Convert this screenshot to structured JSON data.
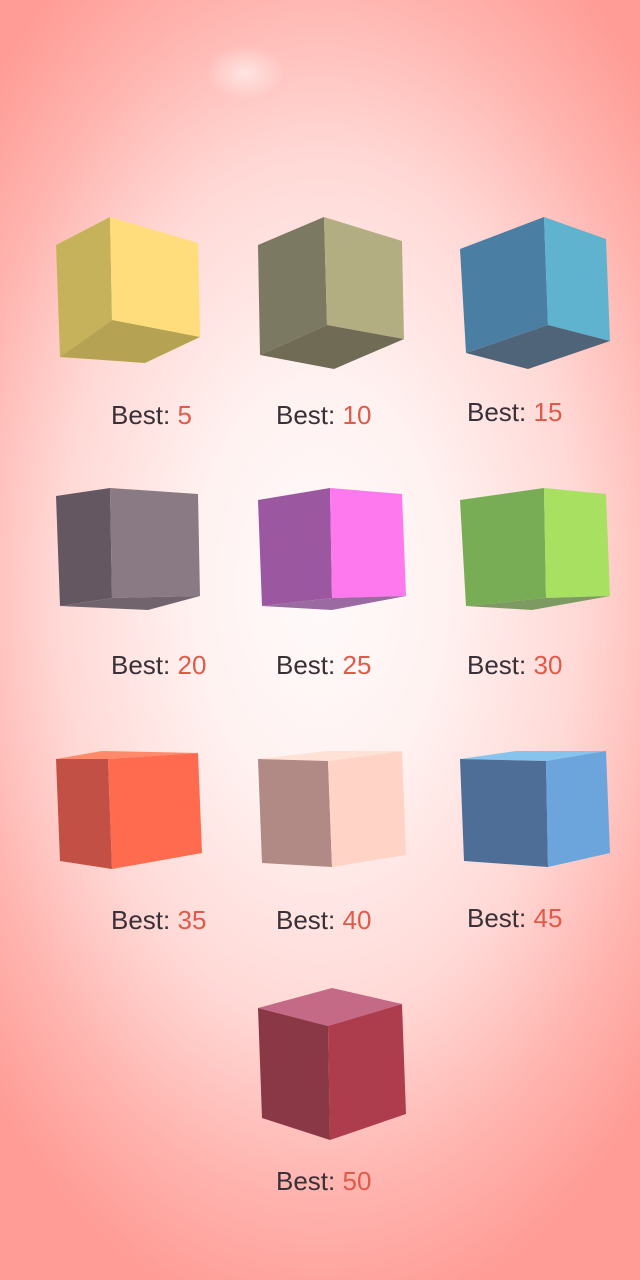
{
  "skins": [
    {
      "label": "Best: ",
      "value": "5",
      "top": "#ffe6a0",
      "left": "#c7b25c",
      "right": "#ffdd7c",
      "bottom": "#b5a253",
      "view": "under"
    },
    {
      "label": "Best: ",
      "value": "10",
      "top": "#c8c396",
      "left": "#7b7961",
      "right": "#b3ae81",
      "bottom": "#6f6b55",
      "view": "under"
    },
    {
      "label": "Best: ",
      "value": "15",
      "top": "#6cc3dc",
      "left": "#4a7fa3",
      "right": "#5fb3cf",
      "bottom": "#4f6478",
      "view": "under"
    },
    {
      "label": "Best: ",
      "value": "20",
      "top": "#9c8a92",
      "left": "#655761",
      "right": "#8a7a84",
      "bottom": "#72646d",
      "view": "flat"
    },
    {
      "label": "Best: ",
      "value": "25",
      "top": "#ff8cf0",
      "left": "#9b58a1",
      "right": "#fe78ee",
      "bottom": "#9a6aa0",
      "view": "flat"
    },
    {
      "label": "Best: ",
      "value": "30",
      "top": "#b7ea70",
      "left": "#78ad55",
      "right": "#a8e062",
      "bottom": "#7c9a62",
      "view": "flat"
    },
    {
      "label": "Best: ",
      "value": "35",
      "top": "#ff8a6a",
      "left": "#c25044",
      "right": "#ff6b4f",
      "bottom": "#b04638",
      "view": "over"
    },
    {
      "label": "Best: ",
      "value": "40",
      "top": "#ffe2d6",
      "left": "#b18985",
      "right": "#ffd4c6",
      "bottom": "#a37a76",
      "view": "over"
    },
    {
      "label": "Best: ",
      "value": "45",
      "top": "#86c4ee",
      "left": "#4e6e98",
      "right": "#6ca4dc",
      "bottom": "#445e84",
      "view": "over"
    },
    {
      "label": "Best: ",
      "value": "50",
      "top": "#c46a86",
      "left": "#8a3845",
      "right": "#ad3c4d",
      "bottom": "#7c3040",
      "view": "over"
    }
  ]
}
